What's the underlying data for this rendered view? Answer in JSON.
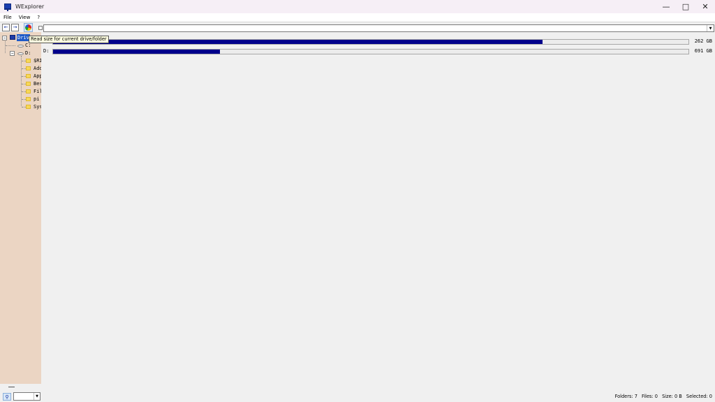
{
  "window": {
    "title": "WExplorer"
  },
  "menu": {
    "items": [
      "File",
      "View",
      "?"
    ]
  },
  "toolbar": {
    "back_icon": "arrow-left-icon",
    "forward_icon": "arrow-right-icon",
    "readsize_icon": "pie-chart-icon",
    "tooltip": "Read size for current drive/folder",
    "path_value": ""
  },
  "tree": {
    "root_label": "Driv",
    "drives": [
      "C:",
      "D:"
    ],
    "folders": [
      "$RI",
      "Ado",
      "App",
      "Bes",
      "Fil",
      "pi",
      "Sys"
    ]
  },
  "drives_list": [
    {
      "letter": "C:",
      "size": "262 GB",
      "used_fraction": 0.77
    },
    {
      "letter": "D:",
      "size": "691 GB",
      "used_fraction": 0.263
    }
  ],
  "status": {
    "folders": "Folders: 7",
    "files": "Files: 0",
    "size": "Size: 0 B",
    "selected": "Selected: 0"
  },
  "colors": {
    "bar_fill": "#00008b",
    "tree_bg": "#ebd5c3",
    "selection": "#1e5ac8"
  }
}
